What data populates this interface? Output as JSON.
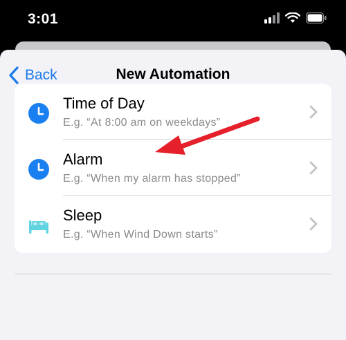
{
  "status_bar": {
    "time": "3:01",
    "icons": [
      "cellular-signal-icon",
      "wifi-icon",
      "battery-icon"
    ]
  },
  "nav": {
    "back_label": "Back",
    "title": "New Automation"
  },
  "list": [
    {
      "title": "Time of Day",
      "subtitle": "E.g. “At 8:00 am on weekdays”",
      "icon": "clock-icon"
    },
    {
      "title": "Alarm",
      "subtitle": "E.g. “When my alarm has stopped”",
      "icon": "alarm-clock-icon"
    },
    {
      "title": "Sleep",
      "subtitle": "E.g. “When Wind Down starts”",
      "icon": "bed-icon"
    }
  ],
  "colors": {
    "accent_blue": "#1b7aeb",
    "clock_blue": "#1a7ff0",
    "bed_teal": "#5fd3df",
    "annotation_red": "#e5202a"
  }
}
